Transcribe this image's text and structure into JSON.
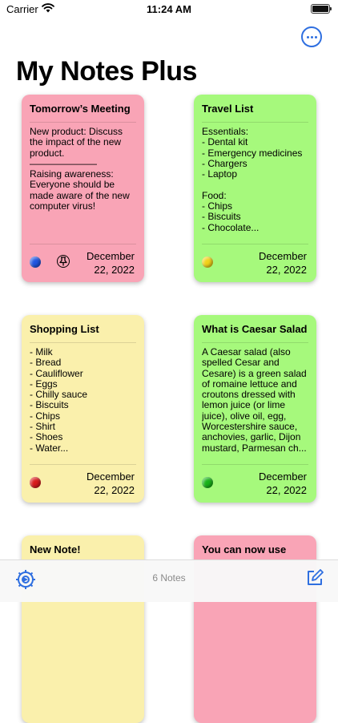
{
  "status_bar": {
    "carrier": "Carrier",
    "time": "11:24 AM"
  },
  "header": {
    "title": "My Notes Plus",
    "more_icon": "ellipsis-circle-icon"
  },
  "notes": [
    {
      "title": "Tomorrow’s Meeting",
      "body": "New product: Discuss the impact of the new product.\n———————\nRaising awareness: Everyone should be made aware of the new computer virus!",
      "date": "December 22, 2022",
      "color": "#f9a4b6",
      "dot_color": "#1f55e0",
      "pinned": true
    },
    {
      "title": "Travel List",
      "body": "Essentials:\n- Dental kit\n- Emergency medicines\n- Chargers\n- Laptop\n\nFood:\n- Chips\n- Biscuits\n- Chocolate...",
      "date": "December 22, 2022",
      "color": "#a6f97c",
      "dot_color": "#f2d219",
      "pinned": false
    },
    {
      "title": "Shopping List",
      "body": "- Milk\n- Bread\n- Cauliflower\n- Eggs\n- Chilly sauce\n- Biscuits\n- Chips\n- Shirt\n- Shoes\n- Water...",
      "date": "December 22, 2022",
      "color": "#faf0ac",
      "dot_color": "#d81c1c",
      "pinned": false
    },
    {
      "title": "What is Caesar Salad",
      "body": "A Caesar salad (also spelled Cesar and Cesare) is a green salad of romaine lettuce and croutons dressed with lemon juice (or lime juice), olive oil, egg, Worcestershire sauce, anchovies, garlic, Dijon mustard, Parmesan ch...",
      "date": "December 22, 2022",
      "color": "#a6f97c",
      "dot_color": "#19b319",
      "pinned": false
    },
    {
      "title": "New Note!",
      "body": "",
      "date": "",
      "color": "#faf0ac",
      "dot_color": "",
      "pinned": false
    },
    {
      "title": "You can now use",
      "body": "",
      "date": "",
      "color": "#f9a4b6",
      "dot_color": "",
      "pinned": false
    }
  ],
  "toolbar": {
    "count_label": "6 Notes",
    "settings_icon": "gear-icon",
    "compose_icon": "compose-icon"
  },
  "colors": {
    "accent": "#2f6fe0"
  }
}
